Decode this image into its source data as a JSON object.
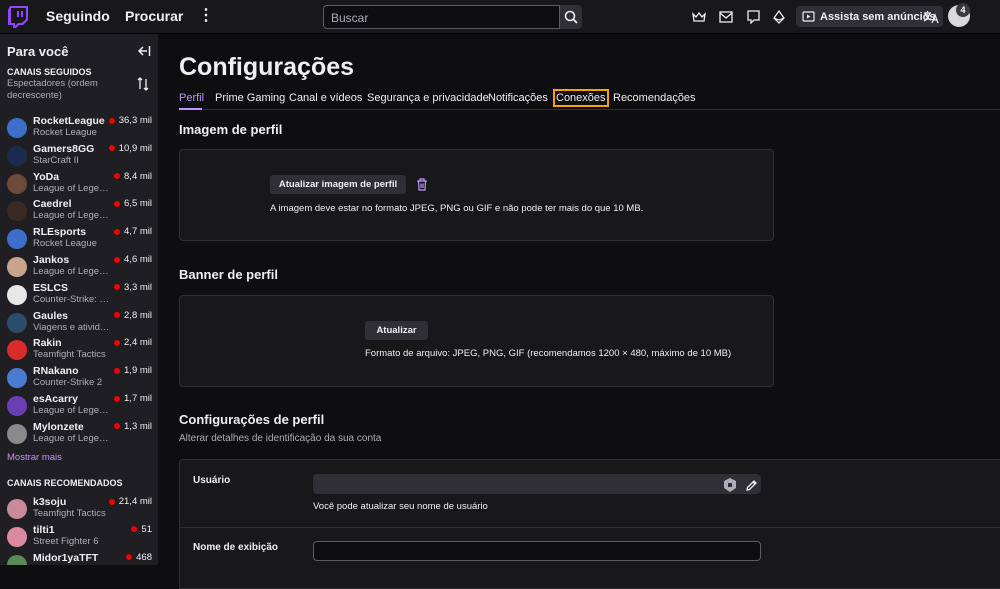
{
  "topnav": {
    "following_label": "Seguindo",
    "browse_label": "Procurar",
    "more_label": "⋮",
    "search_placeholder": "Buscar",
    "ads_label": "Assista sem anúncios",
    "notification_count": "4"
  },
  "sidebar": {
    "title": "Para você",
    "followed_heading": "CANAIS SEGUIDOS",
    "followed_sort": "Espectadores (ordem decrescente)",
    "followed": [
      {
        "name": "RocketLeague",
        "game": "Rocket League",
        "viewers": "36,3 mil",
        "avatar_color": "#3d6ec9"
      },
      {
        "name": "Gamers8GG",
        "game": "StarCraft II",
        "viewers": "10,9 mil",
        "avatar_color": "#1a2b4d"
      },
      {
        "name": "YoDa",
        "game": "League of Legends",
        "viewers": "8,4 mil",
        "avatar_color": "#6b4a3a"
      },
      {
        "name": "Caedrel",
        "game": "League of Legends",
        "viewers": "6,5 mil",
        "avatar_color": "#3b2a24"
      },
      {
        "name": "RLEsports",
        "game": "Rocket League",
        "viewers": "4,7 mil",
        "avatar_color": "#3d6ec9"
      },
      {
        "name": "Jankos",
        "game": "League of Legends",
        "viewers": "4,6 mil",
        "avatar_color": "#c9a48a"
      },
      {
        "name": "ESLCS",
        "game": "Counter-Strike: Global Offensive",
        "viewers": "3,3 mil",
        "avatar_color": "#e8e8e8"
      },
      {
        "name": "Gaules",
        "game": "Viagens e atividades",
        "viewers": "2,8 mil",
        "avatar_color": "#2a4d6b"
      },
      {
        "name": "Rakin",
        "game": "Teamfight Tactics",
        "viewers": "2,4 mil",
        "avatar_color": "#d92b2b"
      },
      {
        "name": "RNakano",
        "game": "Counter-Strike 2",
        "viewers": "1,9 mil",
        "avatar_color": "#4a7bd1"
      },
      {
        "name": "esAcarry",
        "game": "League of Legends",
        "viewers": "1,7 mil",
        "avatar_color": "#6a3fb5"
      },
      {
        "name": "Mylonzete",
        "game": "League of Legends",
        "viewers": "1,3 mil",
        "avatar_color": "#8a8a8a"
      }
    ],
    "show_more": "Mostrar mais",
    "recommended_heading": "CANAIS RECOMENDADOS",
    "recommended": [
      {
        "name": "k3soju",
        "game": "Teamfight Tactics",
        "viewers": "21,4 mil",
        "avatar_color": "#c98a9a"
      },
      {
        "name": "tilti1",
        "game": "Street Fighter 6",
        "viewers": "51",
        "avatar_color": "#d98aa0"
      },
      {
        "name": "Midor1yaTFT",
        "game": "",
        "viewers": "468",
        "avatar_color": "#5a8a5a"
      }
    ]
  },
  "page": {
    "title": "Configurações",
    "tabs": [
      "Perfil",
      "Prime Gaming",
      "Canal e vídeos",
      "Segurança e privacidade",
      "Notificações",
      "Conexões",
      "Recomendações"
    ],
    "profile_image": {
      "heading": "Imagem de perfil",
      "button": "Atualizar imagem de perfil",
      "hint": "A imagem deve estar no formato JPEG, PNG ou GIF e não pode ter mais do que 10 MB."
    },
    "banner": {
      "heading": "Banner de perfil",
      "button": "Atualizar",
      "hint": "Formato de arquivo: JPEG, PNG, GIF (recomendamos 1200 × 480, máximo de 10 MB)"
    },
    "profile_settings": {
      "heading": "Configurações de perfil",
      "subheading": "Alterar detalhes de identificação da sua conta",
      "username_label": "Usuário",
      "username_hint": "Você pode atualizar seu nome de usuário",
      "display_name_label": "Nome de exibição"
    }
  },
  "colors": {
    "accent": "#bf94ff",
    "live": "#eb0400",
    "focus": "#f5a400",
    "brand": "#9146ff"
  }
}
